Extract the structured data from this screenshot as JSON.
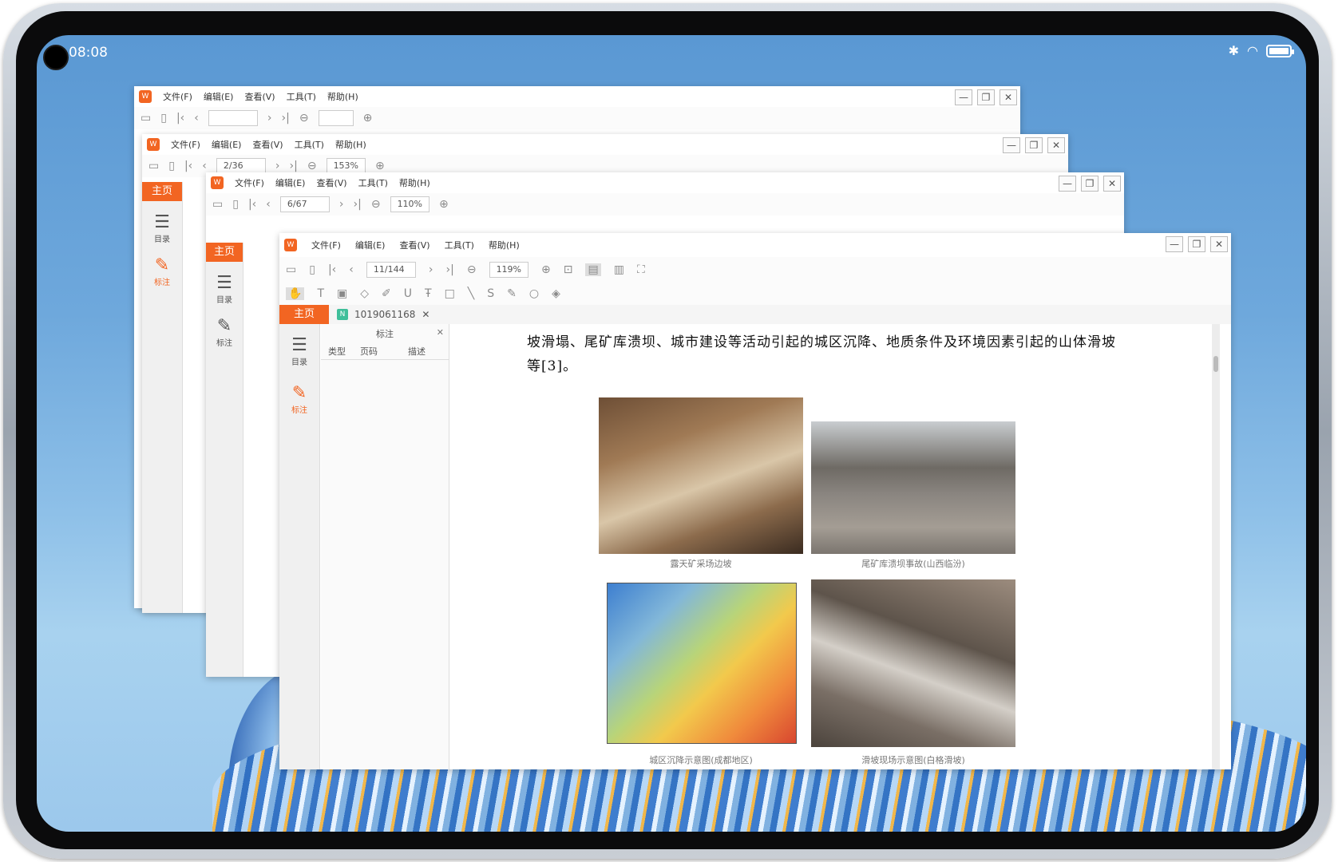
{
  "status": {
    "time": "08:08"
  },
  "menu": [
    "文件(F)",
    "编辑(E)",
    "查看(V)",
    "工具(T)",
    "帮助(H)"
  ],
  "window_buttons": {
    "minimize": "—",
    "restore": "❐",
    "close": "✕"
  },
  "windows": {
    "w1": {
      "page": "",
      "zoom": ""
    },
    "w2": {
      "page": "2/36",
      "zoom": "153%"
    },
    "w3": {
      "page": "6/67",
      "zoom": "110%"
    },
    "front": {
      "page": "11/144",
      "zoom": "119%"
    }
  },
  "sidebar": {
    "home": "主页",
    "toc": "目录",
    "annotate": "标注"
  },
  "doc_tab": {
    "name": "1019061168",
    "icon": "N"
  },
  "annotation_panel": {
    "title": "标注",
    "columns": [
      "类型",
      "页码",
      "描述"
    ]
  },
  "document": {
    "text": "坡滑塌、尾矿库溃坝、城市建设等活动引起的城区沉降、地质条件及环境因素引起的山体滑坡等[3]。",
    "captions": [
      "露天矿采场边坡",
      "尾矿库溃坝事故(山西临汾)",
      "城区沉降示意图(成都地区)",
      "滑坡现场示意图(白格滑坡)"
    ]
  }
}
